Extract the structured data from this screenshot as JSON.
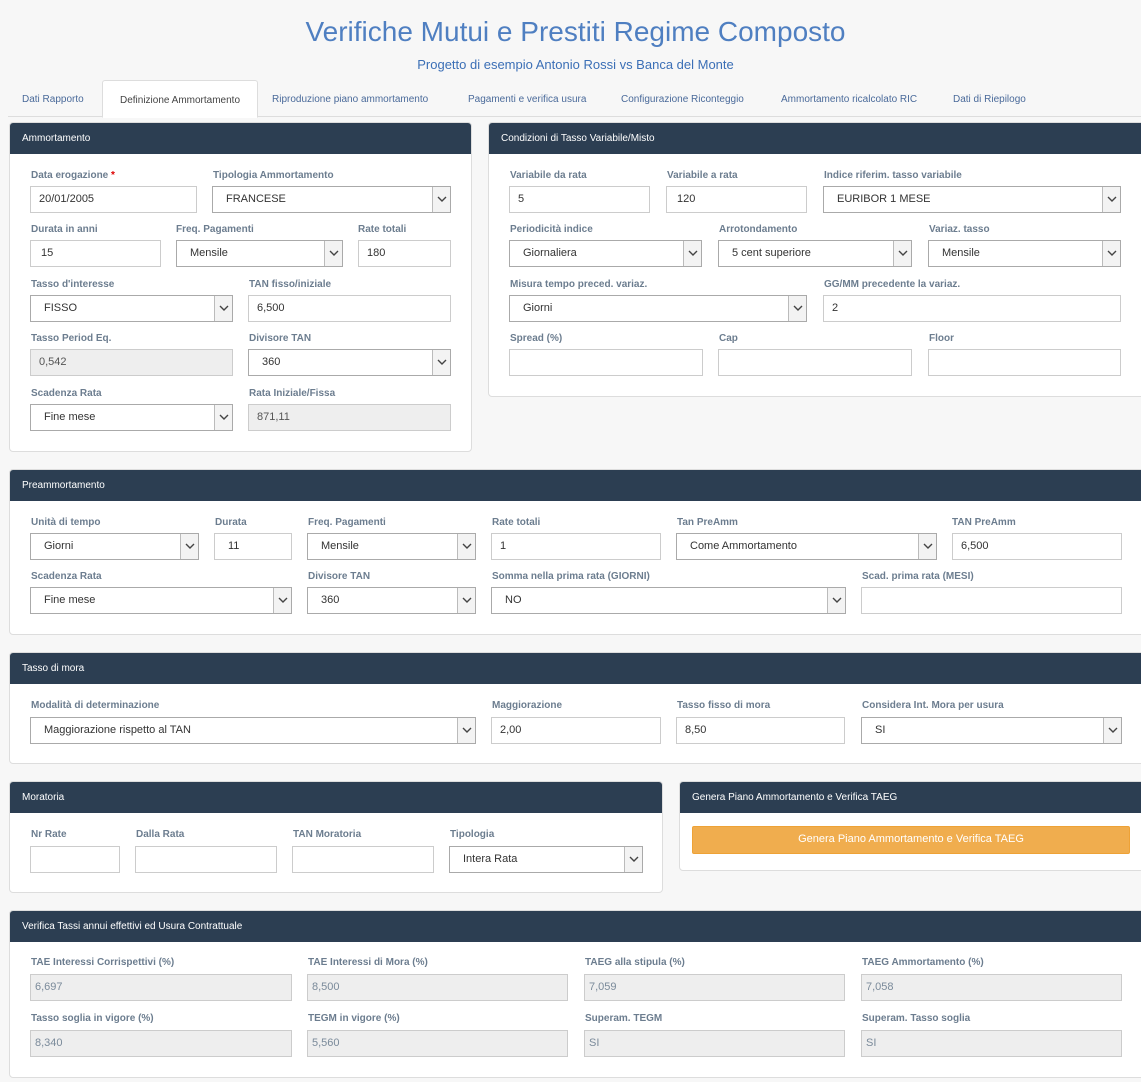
{
  "header": {
    "title": "Verifiche Mutui e Prestiti Regime Composto",
    "subtitle": "Progetto di esempio Antonio Rossi vs Banca del Monte"
  },
  "tabs": [
    {
      "label": "Dati Rapporto"
    },
    {
      "label": "Definizione Ammortamento"
    },
    {
      "label": "Riproduzione piano ammortamento"
    },
    {
      "label": "Pagamenti e verifica usura"
    },
    {
      "label": "Configurazione Riconteggio"
    },
    {
      "label": "Ammortamento ricalcolato RIC"
    },
    {
      "label": "Dati di Riepilogo"
    }
  ],
  "active_tab": "Definizione Ammortamento",
  "ammortamento": {
    "title": "Ammortamento",
    "required_mark": "*",
    "data_erogazione": {
      "label": "Data erogazione",
      "value": "20/01/2005"
    },
    "tipologia": {
      "label": "Tipologia Ammortamento",
      "value": "FRANCESE"
    },
    "durata": {
      "label": "Durata in anni",
      "value": "15"
    },
    "freq": {
      "label": "Freq. Pagamenti",
      "value": "Mensile"
    },
    "rate_totali": {
      "label": "Rate totali",
      "value": "180"
    },
    "tasso": {
      "label": "Tasso d'interesse",
      "value": "FISSO"
    },
    "tan": {
      "label": "TAN fisso/iniziale",
      "value": "6,500"
    },
    "tasso_period": {
      "label": "Tasso Period Eq.",
      "value": "0,542"
    },
    "divisore": {
      "label": "Divisore TAN",
      "value": "360"
    },
    "scadenza": {
      "label": "Scadenza Rata",
      "value": "Fine mese"
    },
    "rata": {
      "label": "Rata Iniziale/Fissa",
      "value": "871,11"
    }
  },
  "variabile": {
    "title": "Condizioni di Tasso Variabile/Misto",
    "da_rata": {
      "label": "Variabile da rata",
      "value": "5"
    },
    "a_rata": {
      "label": "Variabile a rata",
      "value": "120"
    },
    "indice": {
      "label": "Indice riferim. tasso variabile",
      "value": "EURIBOR 1 MESE"
    },
    "periodicita": {
      "label": "Periodicità indice",
      "value": "Giornaliera"
    },
    "arrotondamento": {
      "label": "Arrotondamento",
      "value": "5 cent superiore"
    },
    "variaz": {
      "label": "Variaz. tasso",
      "value": "Mensile"
    },
    "misura": {
      "label": "Misura tempo preced. variaz.",
      "value": "Giorni"
    },
    "gg": {
      "label": "GG/MM precedente la variaz.",
      "value": "2"
    },
    "spread": {
      "label": "Spread (%)",
      "value": ""
    },
    "cap": {
      "label": "Cap",
      "value": ""
    },
    "floor": {
      "label": "Floor",
      "value": ""
    }
  },
  "preamm": {
    "title": "Preammortamento",
    "unita": {
      "label": "Unità di tempo",
      "value": "Giorni"
    },
    "durata": {
      "label": "Durata",
      "value": "11"
    },
    "freq": {
      "label": "Freq. Pagamenti",
      "value": "Mensile"
    },
    "rate": {
      "label": "Rate totali",
      "value": "1"
    },
    "tan_sel": {
      "label": "Tan PreAmm",
      "value": "Come Ammortamento"
    },
    "tan_val": {
      "label": "TAN PreAmm",
      "value": "6,500"
    },
    "scadenza": {
      "label": "Scadenza Rata",
      "value": "Fine mese"
    },
    "divisore": {
      "label": "Divisore TAN",
      "value": "360"
    },
    "somma": {
      "label": "Somma nella prima rata (GIORNI)",
      "value": "NO"
    },
    "scad_prima": {
      "label": "Scad. prima rata (MESI)",
      "value": ""
    }
  },
  "mora": {
    "title": "Tasso di mora",
    "modalita": {
      "label": "Modalità di determinazione",
      "value": "Maggiorazione rispetto al TAN"
    },
    "maggiorazione": {
      "label": "Maggiorazione",
      "value": "2,00"
    },
    "tasso_fisso": {
      "label": "Tasso fisso di mora",
      "value": "8,50"
    },
    "considera": {
      "label": "Considera Int. Mora per usura",
      "value": "SI"
    }
  },
  "moratoria": {
    "title": "Moratoria",
    "nr_rate": {
      "label": "Nr Rate",
      "value": ""
    },
    "dalla_rata": {
      "label": "Dalla Rata",
      "value": ""
    },
    "tan": {
      "label": "TAN Moratoria",
      "value": ""
    },
    "tipologia": {
      "label": "Tipologia",
      "value": "Intera Rata"
    }
  },
  "genera": {
    "title": "Genera Piano Ammortamento e Verifica TAEG",
    "button": "Genera Piano Ammortamento e Verifica TAEG"
  },
  "verifica": {
    "title": "Verifica Tassi annui effettivi ed Usura Contrattuale",
    "tae_corr": {
      "label": "TAE Interessi Corrispettivi (%)",
      "value": "6,697"
    },
    "tae_mora": {
      "label": "TAE Interessi di Mora (%)",
      "value": "8,500"
    },
    "taeg_stipula": {
      "label": "TAEG alla stipula (%)",
      "value": "7,059"
    },
    "taeg_amm": {
      "label": "TAEG Ammortamento (%)",
      "value": "7,058"
    },
    "soglia": {
      "label": "Tasso soglia in vigore (%)",
      "value": "8,340"
    },
    "tegm": {
      "label": "TEGM in vigore (%)",
      "value": "5,560"
    },
    "superam_tegm": {
      "label": "Superam. TEGM",
      "value": "SI"
    },
    "superam_soglia": {
      "label": "Superam. Tasso soglia",
      "value": "SI"
    }
  }
}
